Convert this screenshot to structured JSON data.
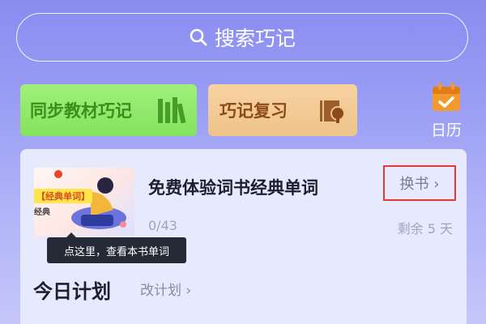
{
  "search": {
    "label": "搜索巧记",
    "icon": "search-icon"
  },
  "shortcuts": {
    "sync_label": "同步教材巧记",
    "sync_icon": "books-icon",
    "review_label": "巧记复习",
    "review_icon": "review-book-icon"
  },
  "calendar": {
    "label": "日历",
    "icon": "calendar-icon"
  },
  "book": {
    "cover_tag": "【经典单词】",
    "cover_sub": "经典",
    "title": "免费体验词书经典单词",
    "swap_label": "换书 ›",
    "progress": "0/43",
    "remaining": "剩余 5 天"
  },
  "tooltip": "点这里，查看本书单词",
  "plan": {
    "title": "今日计划",
    "edit_label": "改计划 ›"
  },
  "colors": {
    "accent_green": "#84e35e",
    "accent_orange": "#efc389",
    "highlight_red": "#e53935"
  }
}
